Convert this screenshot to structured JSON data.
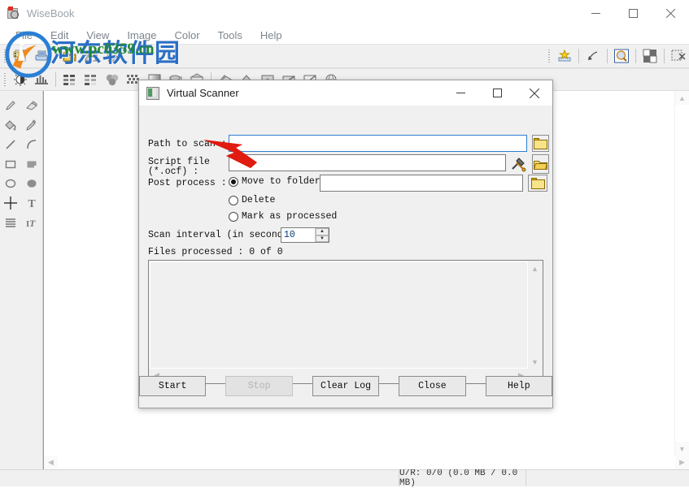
{
  "app": {
    "title": "WiseBook",
    "window_controls": [
      "minimize",
      "maximize",
      "close"
    ]
  },
  "menubar": {
    "items": [
      {
        "label": "File"
      },
      {
        "label": "Edit"
      },
      {
        "label": "View"
      },
      {
        "label": "Image"
      },
      {
        "label": "Color"
      },
      {
        "label": "Tools"
      },
      {
        "label": "Help"
      }
    ]
  },
  "toolbar_top": {
    "icons": [
      "new-document-icon",
      "scanner-icon",
      "open-folder-icon",
      "save-icon",
      "paperclip-icon",
      "brightness-icon",
      "histogram-icon",
      "sun-star-icon",
      "arrow-diagonal-icon",
      "magnifier-icon",
      "checkerboard-icon",
      "select-region-icon"
    ]
  },
  "toolbar_second": {
    "icons": [
      "contrast-icon",
      "levels-icon",
      "thumbnails-large-icon",
      "thumbnails-small-icon",
      "two-circles-icon",
      "halftone-icon",
      "gradient-icon",
      "despeckle-icon",
      "deskew-icon",
      "eraser-area-icon",
      "smooth-icon",
      "crop-icon",
      "rotate-icon",
      "flip-icon",
      "invert-icon",
      "globe-icon"
    ]
  },
  "tool_palette": {
    "tools": [
      "pencil-icon",
      "eraser-icon",
      "paint-bucket-icon",
      "eyedropper-icon",
      "line-icon",
      "curve-icon",
      "rectangle-icon",
      "filled-rectangle-icon",
      "ellipse-icon",
      "filled-ellipse-icon",
      "crosshair-icon",
      "text-icon",
      "lines-icon",
      "italic-text-icon"
    ]
  },
  "statusbar": {
    "left": "",
    "center": "U/R: 0/0  (0.0 MB / 0.0 MB)",
    "right": ""
  },
  "watermark": {
    "chinese": "河东软件园",
    "url": "www.pc0359.cn"
  },
  "dialog": {
    "title": "Virtual Scanner",
    "icon": "app-small-icon",
    "window_controls": [
      "minimize",
      "maximize",
      "close"
    ],
    "fields": {
      "path_to_scan": {
        "label": "Path to scan :",
        "value": "",
        "placeholder": "",
        "browse_icon": "folder-icon"
      },
      "script_file": {
        "label_line1": "Script file",
        "label_line2": "(*.ocf) :",
        "value": "",
        "placeholder": "",
        "edit_icon": "hammer-wrench-icon",
        "browse_icon": "open-folder-icon"
      },
      "post_process": {
        "label": "Post process :",
        "selected": "move_to_folder",
        "options": [
          {
            "id": "move_to_folder",
            "label": "Move to folder",
            "checked": true
          },
          {
            "id": "delete",
            "label": "Delete",
            "checked": false
          },
          {
            "id": "mark_as_processed",
            "label": "Mark as processed",
            "checked": false
          }
        ],
        "move_folder_value": "",
        "browse_icon": "folder-icon"
      },
      "scan_interval": {
        "label": "Scan interval (in seconds) :",
        "value": "10"
      },
      "files_processed": {
        "label": "Files processed : 0 of 0"
      }
    },
    "log": {
      "content": ""
    },
    "buttons": [
      {
        "label": "Start",
        "enabled": true
      },
      {
        "label": "Stop",
        "enabled": false
      },
      {
        "label": "Clear Log",
        "enabled": true
      },
      {
        "label": "Close",
        "enabled": true
      },
      {
        "label": "Help",
        "enabled": true
      }
    ]
  },
  "annotation": {
    "arrow_color": "#e01b10"
  }
}
